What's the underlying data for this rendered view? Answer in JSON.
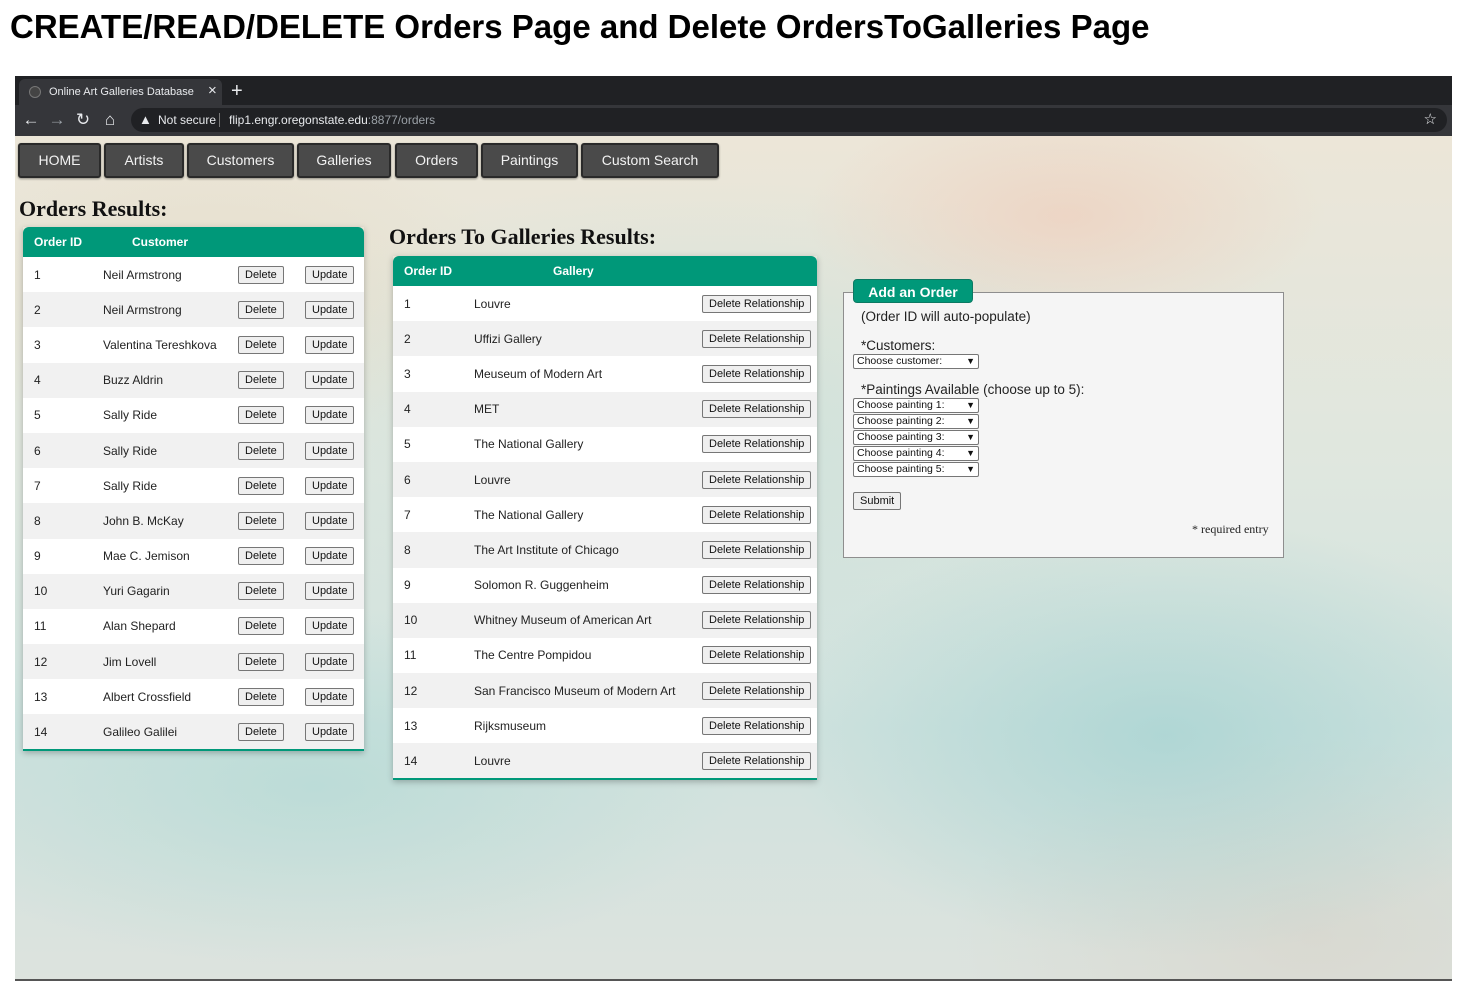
{
  "document_title": "CREATE/READ/DELETE Orders Page and Delete OrdersToGalleries Page",
  "browser": {
    "tab_title": "Online Art Galleries Database",
    "tab_close": "×",
    "new_tab": "+",
    "security_label": "Not secure",
    "url_host": "flip1.engr.oregonstate.edu",
    "url_rest": ":8877/orders"
  },
  "nav": [
    "HOME",
    "Artists",
    "Customers",
    "Galleries",
    "Orders",
    "Paintings",
    "Custom Search"
  ],
  "orders": {
    "title": "Orders Results:",
    "columns": [
      "Order ID",
      "Customer"
    ],
    "delete_label": "Delete",
    "update_label": "Update",
    "rows": [
      {
        "id": "1",
        "customer": "Neil Armstrong"
      },
      {
        "id": "2",
        "customer": "Neil Armstrong"
      },
      {
        "id": "3",
        "customer": "Valentina Tereshkova"
      },
      {
        "id": "4",
        "customer": "Buzz Aldrin"
      },
      {
        "id": "5",
        "customer": "Sally Ride"
      },
      {
        "id": "6",
        "customer": "Sally Ride"
      },
      {
        "id": "7",
        "customer": "Sally Ride"
      },
      {
        "id": "8",
        "customer": "John B. McKay"
      },
      {
        "id": "9",
        "customer": "Mae C. Jemison"
      },
      {
        "id": "10",
        "customer": "Yuri Gagarin"
      },
      {
        "id": "11",
        "customer": "Alan Shepard"
      },
      {
        "id": "12",
        "customer": "Jim Lovell"
      },
      {
        "id": "13",
        "customer": "Albert Crossfield"
      },
      {
        "id": "14",
        "customer": "Galileo Galilei"
      }
    ]
  },
  "orders_to_galleries": {
    "title": "Orders To Galleries Results:",
    "columns": [
      "Order ID",
      "Gallery"
    ],
    "delete_label": "Delete Relationship",
    "rows": [
      {
        "id": "1",
        "gallery": "Louvre"
      },
      {
        "id": "2",
        "gallery": "Uffizi Gallery"
      },
      {
        "id": "3",
        "gallery": "Meuseum of Modern Art"
      },
      {
        "id": "4",
        "gallery": "MET"
      },
      {
        "id": "5",
        "gallery": "The National Gallery"
      },
      {
        "id": "6",
        "gallery": "Louvre"
      },
      {
        "id": "7",
        "gallery": "The National Gallery"
      },
      {
        "id": "8",
        "gallery": "The Art Institute of Chicago"
      },
      {
        "id": "9",
        "gallery": "Solomon R. Guggenheim"
      },
      {
        "id": "10",
        "gallery": "Whitney Museum of American Art"
      },
      {
        "id": "11",
        "gallery": "The Centre Pompidou"
      },
      {
        "id": "12",
        "gallery": "San Francisco Museum of Modern Art"
      },
      {
        "id": "13",
        "gallery": "Rijksmuseum"
      },
      {
        "id": "14",
        "gallery": "Louvre"
      }
    ]
  },
  "add_order": {
    "legend": "Add an Order",
    "note": "(Order ID will auto-populate)",
    "customers_label": "*Customers:",
    "customer_select": "Choose customer:",
    "paintings_label": "*Paintings Available (choose up to 5):",
    "painting_selects": [
      "Choose painting 1:",
      "Choose painting 2:",
      "Choose painting 3:",
      "Choose painting 4:",
      "Choose painting 5:"
    ],
    "submit_label": "Submit",
    "required_note": "* required entry"
  },
  "colors": {
    "accent": "#009879",
    "nav_bg": "#4a4a4a"
  }
}
